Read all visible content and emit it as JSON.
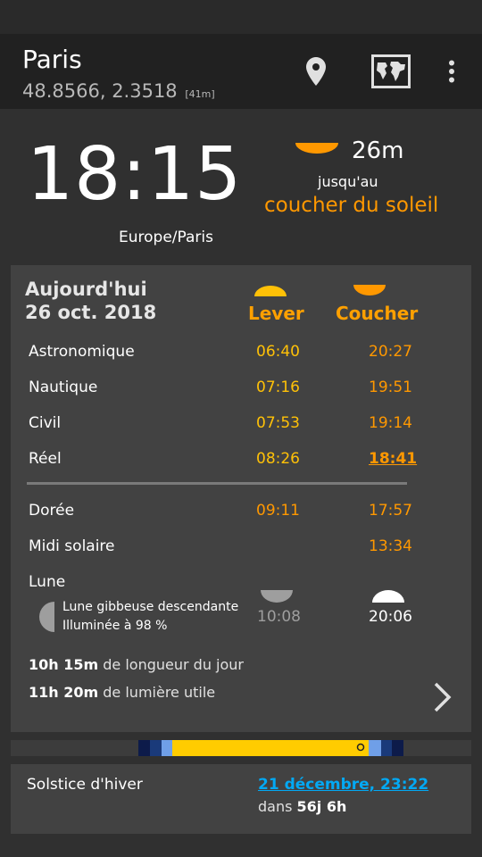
{
  "location": {
    "name": "Paris",
    "coords": "48.8566, 2.3518",
    "altitude": "[41m]"
  },
  "clock": {
    "time": "18:15",
    "timezone": "Europe/Paris"
  },
  "next_event": {
    "duration": "26m",
    "until": "jusqu'au",
    "event": "coucher du soleil"
  },
  "day": {
    "label": "Aujourd'hui",
    "date": "26 oct. 2018",
    "rise_header": "Lever",
    "set_header": "Coucher",
    "rows": [
      {
        "label": "Astronomique",
        "rise": "06:40",
        "set": "20:27"
      },
      {
        "label": "Nautique",
        "rise": "07:16",
        "set": "19:51"
      },
      {
        "label": "Civil",
        "rise": "07:53",
        "set": "19:14"
      },
      {
        "label": "Réel",
        "rise": "08:26",
        "set": "18:41"
      }
    ],
    "golden": {
      "label": "Dorée",
      "rise": "09:11",
      "set": "17:57"
    },
    "noon": {
      "label": "Midi solaire",
      "time": "13:34"
    },
    "moon": {
      "label": "Lune",
      "phase": "Lune gibbeuse descendante",
      "illumination": "Illuminée à 98 %",
      "rise": "10:08",
      "set": "20:06"
    },
    "day_length": {
      "value": "10h 15m",
      "text": "de longueur du jour"
    },
    "daylight": {
      "value": "11h 20m",
      "text": "de lumière utile"
    }
  },
  "solstice": {
    "label": "Solstice d'hiver",
    "date": "21 décembre, 23:22",
    "in_prefix": "dans",
    "in_value": "56j 6h"
  },
  "colors": {
    "accent": "#ff9800",
    "rise": "#ffc107",
    "link": "#03a9f4",
    "card": "#424242"
  },
  "icons": [
    "location-pin-icon",
    "world-map-icon",
    "more-vert-icon",
    "chevron-right-icon",
    "sunrise-icon",
    "sunset-icon",
    "moon-phase-icon",
    "moonrise-icon",
    "moonset-icon"
  ]
}
